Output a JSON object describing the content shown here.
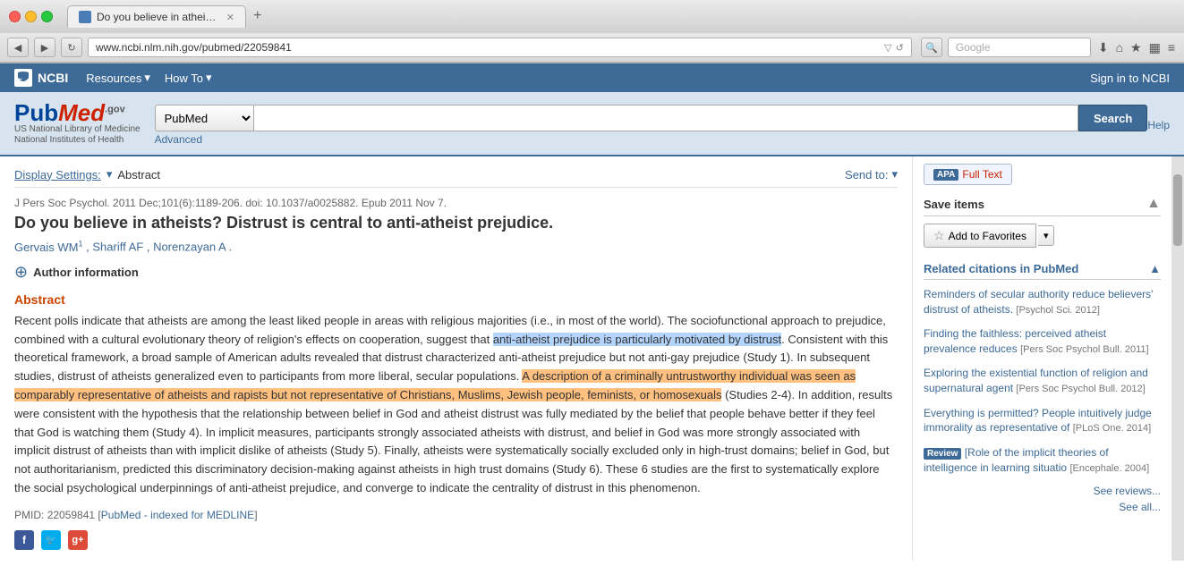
{
  "browser": {
    "tab_title": "Do you believe in atheists...",
    "url": "www.ncbi.nlm.nih.gov/pubmed/22059841",
    "search_placeholder": "Google",
    "add_tab": "+"
  },
  "ncbi_header": {
    "logo": "NCBI",
    "resources": "Resources",
    "how_to": "How To",
    "sign_in": "Sign in to NCBI"
  },
  "pubmed_search": {
    "db_selected": "PubMed",
    "search_btn": "Search",
    "advanced_link": "Advanced",
    "help_link": "Help"
  },
  "display_bar": {
    "display_settings": "Display Settings:",
    "format": "Abstract",
    "send_to": "Send to:"
  },
  "article": {
    "journal_line": "J Pers Soc Psychol. 2011 Dec;101(6):1189-206. doi: 10.1037/a0025882. Epub 2011 Nov 7.",
    "title": "Do you believe in atheists? Distrust is central to anti-atheist prejudice.",
    "authors": "Gervais WM",
    "author2": ", Shariff AF",
    "author3": ", Norenzayan A",
    "author_superscript": "1",
    "author_info": "Author information",
    "abstract_label": "Abstract",
    "abstract_text_1": "Recent polls indicate that atheists are among the least liked people in areas with religious majorities (i.e., in most of the world). The sociofunctional approach to prejudice, combined with a cultural evolutionary theory of religion's effects on cooperation, suggest that ",
    "abstract_highlight_1": "anti-atheist prejudice is particularly motivated by distrust",
    "abstract_text_2": ". Consistent with this theoretical framework, a broad sample of American adults revealed that distrust characterized anti-atheist prejudice but not anti-gay prejudice (Study 1). In subsequent studies, distrust of atheists generalized even to participants from more liberal, secular populations. ",
    "abstract_highlight_2": "A description of a criminally untrustworthy individual was seen as comparably representative of atheists and rapists but not representative of Christians, Muslims, Jewish people, feminists, or homosexuals",
    "abstract_text_3": " (Studies 2-4). In addition, results were consistent with the hypothesis that the relationship between belief in God and atheist distrust was fully mediated by the belief that people behave better if they feel that God is watching them (Study 4). In implicit measures, participants strongly associated atheists with distrust, and belief in God was more strongly associated with implicit distrust of atheists than with implicit dislike of atheists (Study 5). Finally, atheists were systematically socially excluded only in high-trust domains; belief in God, but not authoritarianism, predicted this discriminatory decision-making against atheists in high trust domains (Study 6). These 6 studies are the first to systematically explore the social psychological underpinnings of anti-atheist prejudice, and converge to indicate the centrality of distrust in this phenomenon.",
    "pmid_label": "PMID:",
    "pmid_value": "22059841",
    "pmid_link_text": "PubMed - indexed for MEDLINE"
  },
  "sidebar": {
    "apa_label": "APA",
    "full_text_label": "Full Text",
    "save_items_title": "Save items",
    "add_favorites_label": "Add to Favorites",
    "related_title": "Related citations in PubMed",
    "citations": [
      {
        "title": "Reminders of secular authority reduce believers' distrust of atheists.",
        "source": "[Psychol Sci. 2012]"
      },
      {
        "title": "Finding the faithless: perceived atheist prevalence reduces",
        "source": "[Pers Soc Psychol Bull. 2011]"
      },
      {
        "title": "Exploring the existential function of religion and supernatural agent",
        "source": "[Pers Soc Psychol Bull. 2012]"
      },
      {
        "title": "Everything is permitted? People intuitively judge immorality as representative of",
        "source": "[PLoS One. 2014]"
      },
      {
        "review_badge": "Review",
        "title": "[Role of the implicit theories of intelligence in learning situatio",
        "source": "[Encephale. 2004]"
      }
    ],
    "see_reviews": "See reviews...",
    "see_all": "See all..."
  }
}
